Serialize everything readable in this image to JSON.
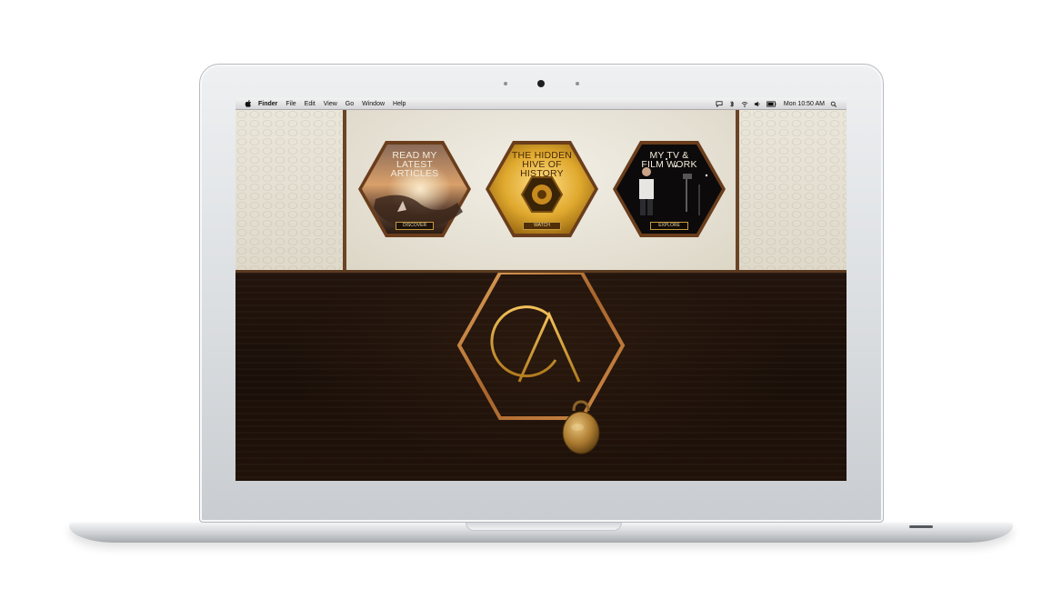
{
  "menubar": {
    "items": [
      "Finder",
      "File",
      "Edit",
      "View",
      "Go",
      "Window",
      "Help"
    ],
    "clock": "Mon 10:50 AM",
    "status_icons": [
      "chat-icon",
      "bluetooth-icon",
      "wifi-icon",
      "volume-icon",
      "battery-icon",
      "spotlight-icon"
    ]
  },
  "hexes": [
    {
      "title_lines": [
        "READ MY",
        "LATEST",
        "ARTICLES"
      ],
      "button": "DISCOVER"
    },
    {
      "title_lines": [
        "THE HIDDEN",
        "HIVE OF",
        "HISTORY"
      ],
      "button": "WATCH"
    },
    {
      "title_lines": [
        "MY TV &",
        "FILM WORK"
      ],
      "button": "EXPLORE"
    }
  ],
  "logo": {
    "letters": "GA"
  },
  "colors": {
    "gold": "#d4a23c",
    "copper": "#b7773a",
    "wood_dark": "#1c110a",
    "parchment": "#e9e5da"
  }
}
